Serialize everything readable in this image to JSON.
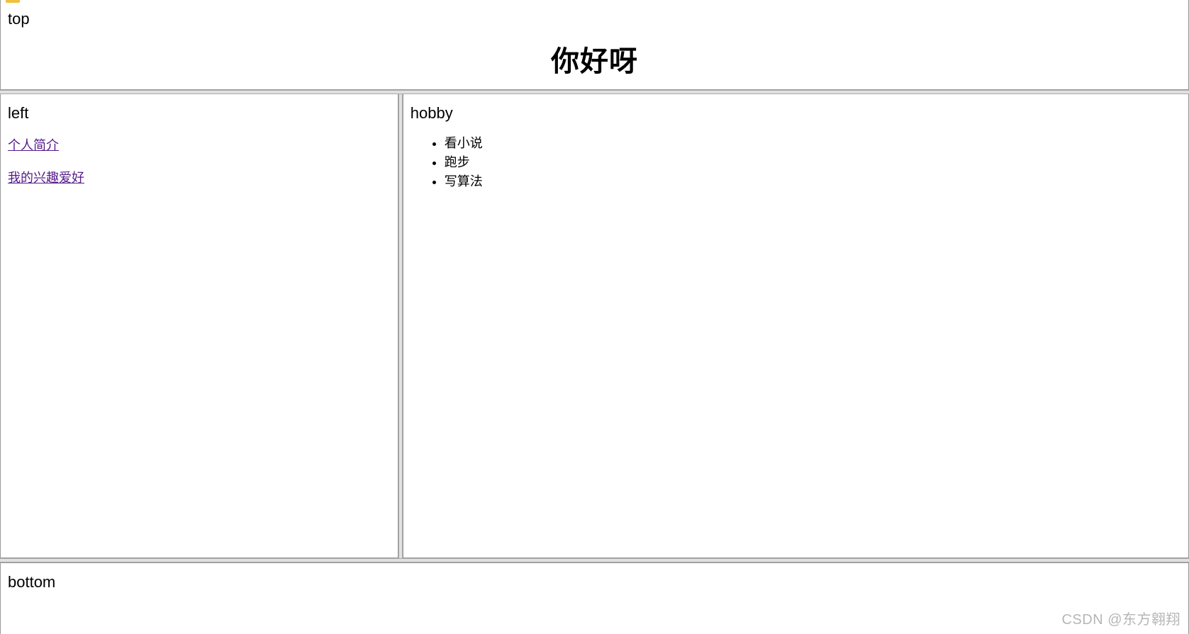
{
  "top": {
    "label": "top",
    "heading": "你好呀"
  },
  "left": {
    "label": "left",
    "links": [
      {
        "text": "个人简介"
      },
      {
        "text": "我的兴趣爱好"
      }
    ]
  },
  "right": {
    "label": "hobby",
    "items": [
      "看小说",
      "跑步",
      "写算法"
    ]
  },
  "bottom": {
    "label": "bottom"
  },
  "watermark": "CSDN @东方翱翔"
}
